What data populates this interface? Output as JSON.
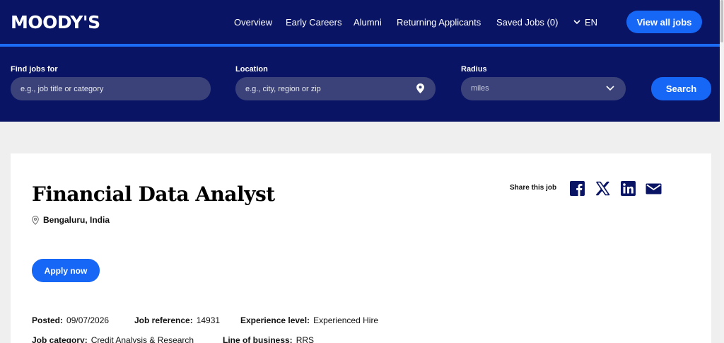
{
  "header": {
    "logo": "MOODY'S",
    "nav": [
      {
        "label": "Overview"
      },
      {
        "label": "Early Careers"
      },
      {
        "label": "Alumni"
      },
      {
        "label": "Returning Applicants"
      },
      {
        "label": "Saved Jobs (0)"
      }
    ],
    "language": "EN",
    "view_all_label": "View all jobs"
  },
  "search": {
    "find_label": "Find jobs for",
    "find_placeholder": "e.g., job title or category",
    "location_label": "Location",
    "location_placeholder": "e.g., city, region or zip",
    "radius_label": "Radius",
    "radius_value": "miles",
    "search_label": "Search"
  },
  "job": {
    "title": "Financial Data Analyst",
    "location": "Bengaluru, India",
    "share_label": "Share this job",
    "share_icons": [
      "facebook-icon",
      "x-icon",
      "linkedin-icon",
      "email-icon"
    ],
    "apply_label": "Apply now",
    "meta": [
      {
        "label": "Posted:",
        "value": "09/07/2026"
      },
      {
        "label": "Job reference:",
        "value": "14931"
      },
      {
        "label": "Experience level:",
        "value": "Experienced Hire"
      }
    ],
    "meta_row2": [
      {
        "label": "Job category:",
        "value": "Credit Analysis & Research"
      },
      {
        "label": "Line of business:",
        "value": "RRS"
      }
    ]
  },
  "colors": {
    "navy": "#0a1464",
    "accent_blue": "#1667f5",
    "field_bg": "#3a4279",
    "page_bg": "#efefef"
  }
}
